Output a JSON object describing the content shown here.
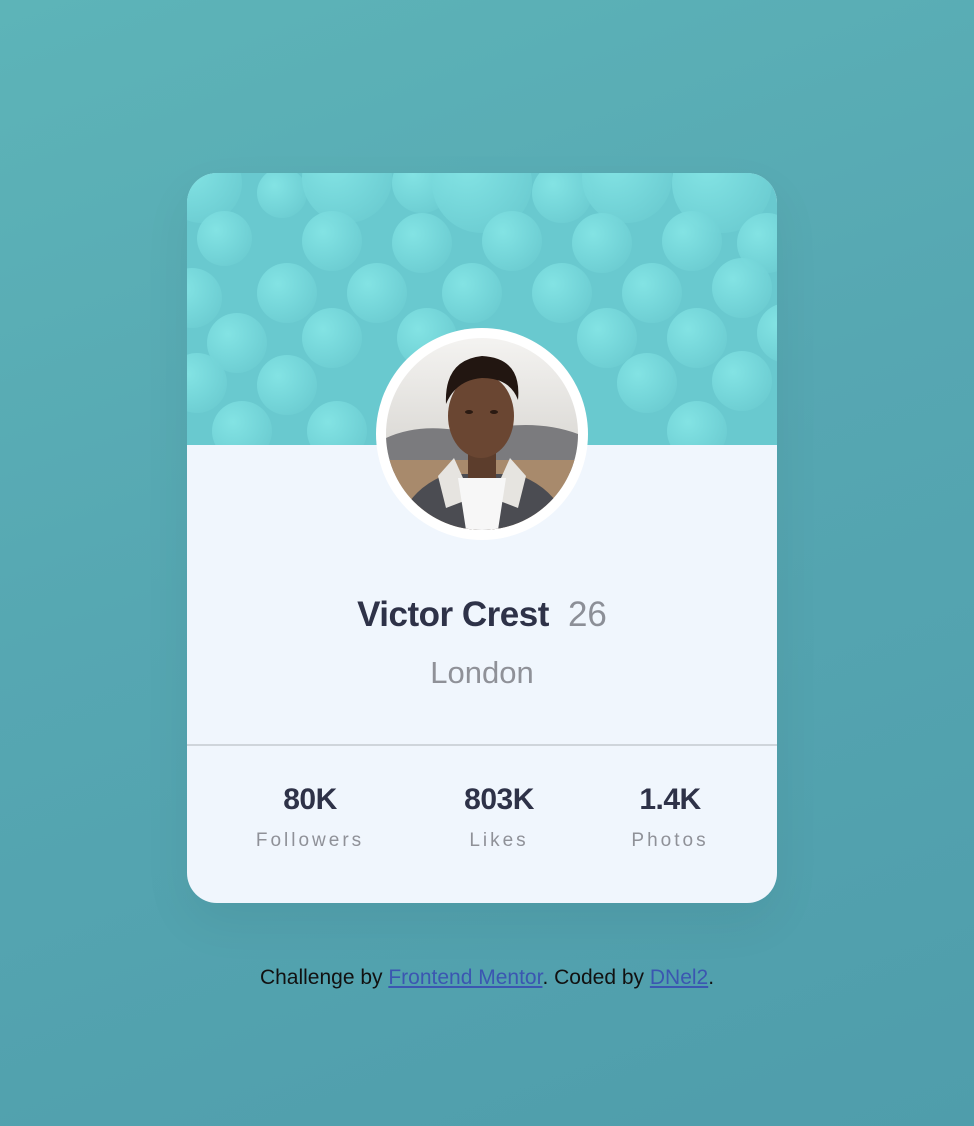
{
  "profile": {
    "name": "Victor Crest",
    "age": "26",
    "city": "London",
    "avatar_icon": "profile-photo-icon"
  },
  "stats": [
    {
      "value": "80K",
      "label": "Followers"
    },
    {
      "value": "803K",
      "label": "Likes"
    },
    {
      "value": "1.4K",
      "label": "Photos"
    }
  ],
  "footer": {
    "prefix": "Challenge by ",
    "link1": "Frontend Mentor",
    "middle": ". Coded by ",
    "link2": "DNel2",
    "suffix": "."
  },
  "colors": {
    "background": "#56a7b2",
    "banner": "#69c9cf",
    "card": "#f0f6fd",
    "text_dark": "#2e3248",
    "text_muted": "#8f9198",
    "link": "#3b56b1"
  }
}
